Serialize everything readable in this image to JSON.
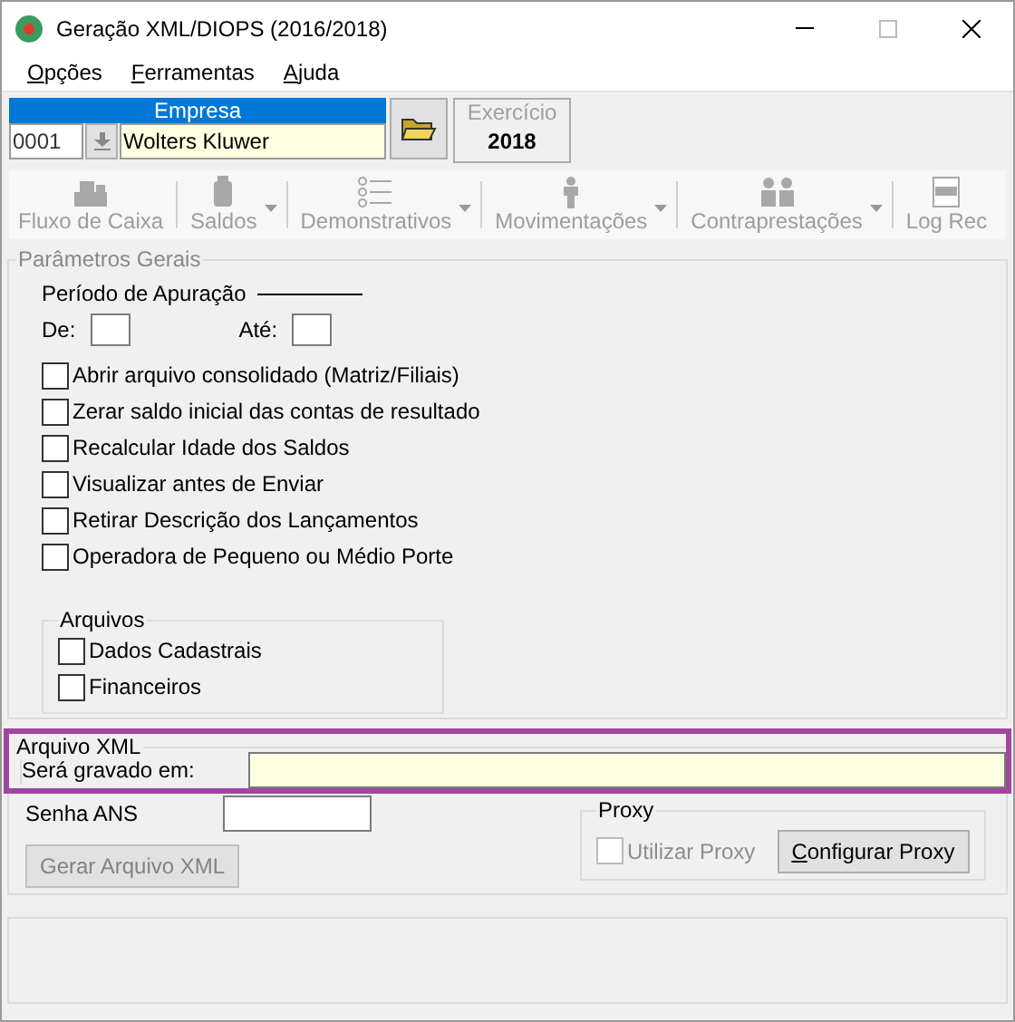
{
  "window": {
    "title": "Geração XML/DIOPS (2016/2018)"
  },
  "menu": [
    "Opções",
    "Ferramentas",
    "Ajuda"
  ],
  "empresa": {
    "label": "Empresa",
    "code": "0001",
    "name": "Wolters Kluwer"
  },
  "exercicio": {
    "label": "Exercício",
    "value": "2018",
    "disabled": true
  },
  "toolbar": [
    {
      "label": "Fluxo de Caixa",
      "kind": "cash",
      "dropdown": false,
      "disabled": true
    },
    {
      "label": "Saldos",
      "kind": "jar",
      "dropdown": true,
      "disabled": true
    },
    {
      "label": "Demonstrativos",
      "kind": "list",
      "dropdown": true,
      "disabled": true
    },
    {
      "label": "Movimentações",
      "kind": "person",
      "dropdown": true,
      "disabled": true
    },
    {
      "label": "Contraprestações",
      "kind": "people",
      "dropdown": true,
      "disabled": true
    },
    {
      "label": "Log Rec",
      "kind": "log",
      "dropdown": false,
      "disabled": true
    }
  ],
  "parametros": {
    "title": "Parâmetros Gerais",
    "periodo": {
      "label": "Período de Apuração",
      "de": "De:",
      "ate": "Até:"
    },
    "options": [
      {
        "label": "Abrir arquivo consolidado (Matriz/Filiais)",
        "checked": false
      },
      {
        "label": "Zerar saldo inicial das contas de resultado",
        "checked": false
      },
      {
        "label": "Recalcular Idade dos Saldos",
        "checked": false
      },
      {
        "label": "Visualizar antes de Enviar",
        "checked": false
      },
      {
        "label": "Retirar Descrição dos Lançamentos",
        "checked": false
      },
      {
        "label": "Operadora de Pequeno ou Médio Porte",
        "checked": false
      }
    ],
    "arquivos": {
      "title": "Arquivos",
      "options": [
        {
          "label": "Dados Cadastrais",
          "checked": false
        },
        {
          "label": "Financeiros",
          "checked": false
        }
      ]
    }
  },
  "arquivo_xml": {
    "title": "Arquivo XML",
    "highlighted": true,
    "label": "Será gravado em:"
  },
  "senha": {
    "label": "Senha ANS"
  },
  "gerar_button": {
    "label": "Gerar Arquivo XML",
    "disabled": true
  },
  "proxy": {
    "title": "Proxy",
    "use": {
      "label": "Utilizar Proxy",
      "checked": false,
      "disabled": true
    },
    "configure": {
      "label": "Configurar Proxy",
      "disabled": false
    }
  }
}
